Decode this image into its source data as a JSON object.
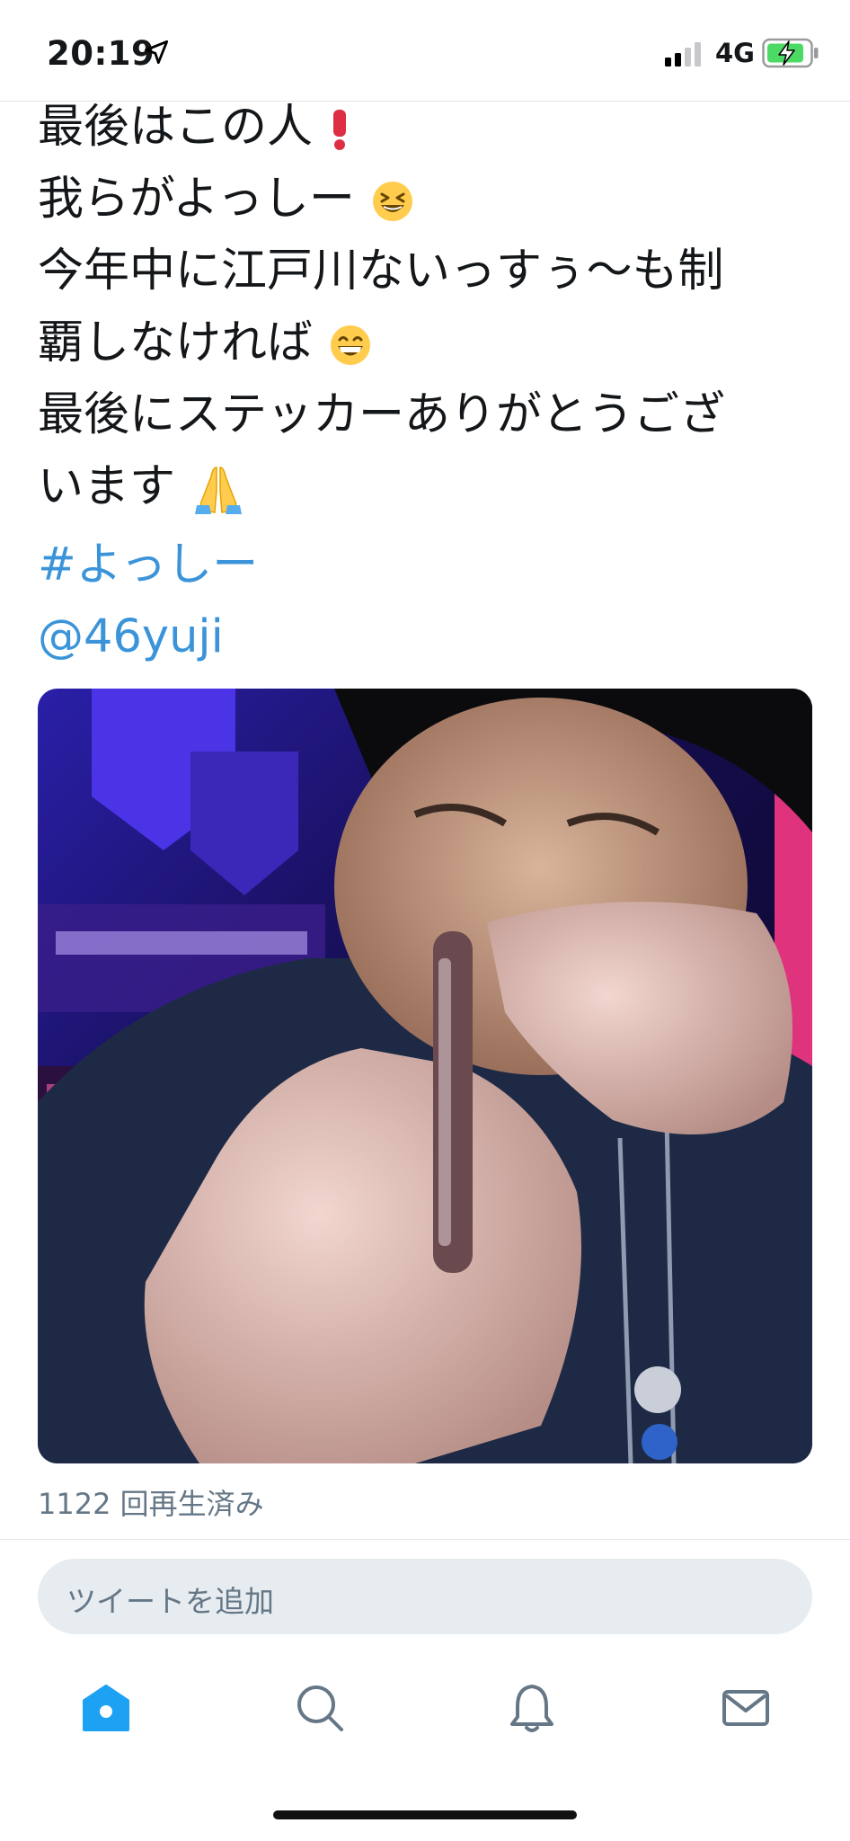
{
  "status_bar": {
    "time": "20:19",
    "network": "4G"
  },
  "tweet": {
    "lines": [
      "最後はこの人",
      "我らがよっしー",
      "今年中に江戸川ないっすぅ〜も制",
      "覇しなければ",
      "最後にステッカーありがとうござ",
      "います"
    ],
    "hashtag": "#よっしー",
    "mention": "@46yuji"
  },
  "video": {
    "view_count_label": "1122 回再生済み"
  },
  "reply_box": {
    "placeholder": "ツイートを追加"
  },
  "tab_bar": {
    "items": [
      "home-icon",
      "search-icon",
      "notifications-icon",
      "messages-icon"
    ]
  },
  "colors": {
    "accent": "#3b94d9",
    "muted": "#657786",
    "reply_bg": "#e6ecf0"
  }
}
